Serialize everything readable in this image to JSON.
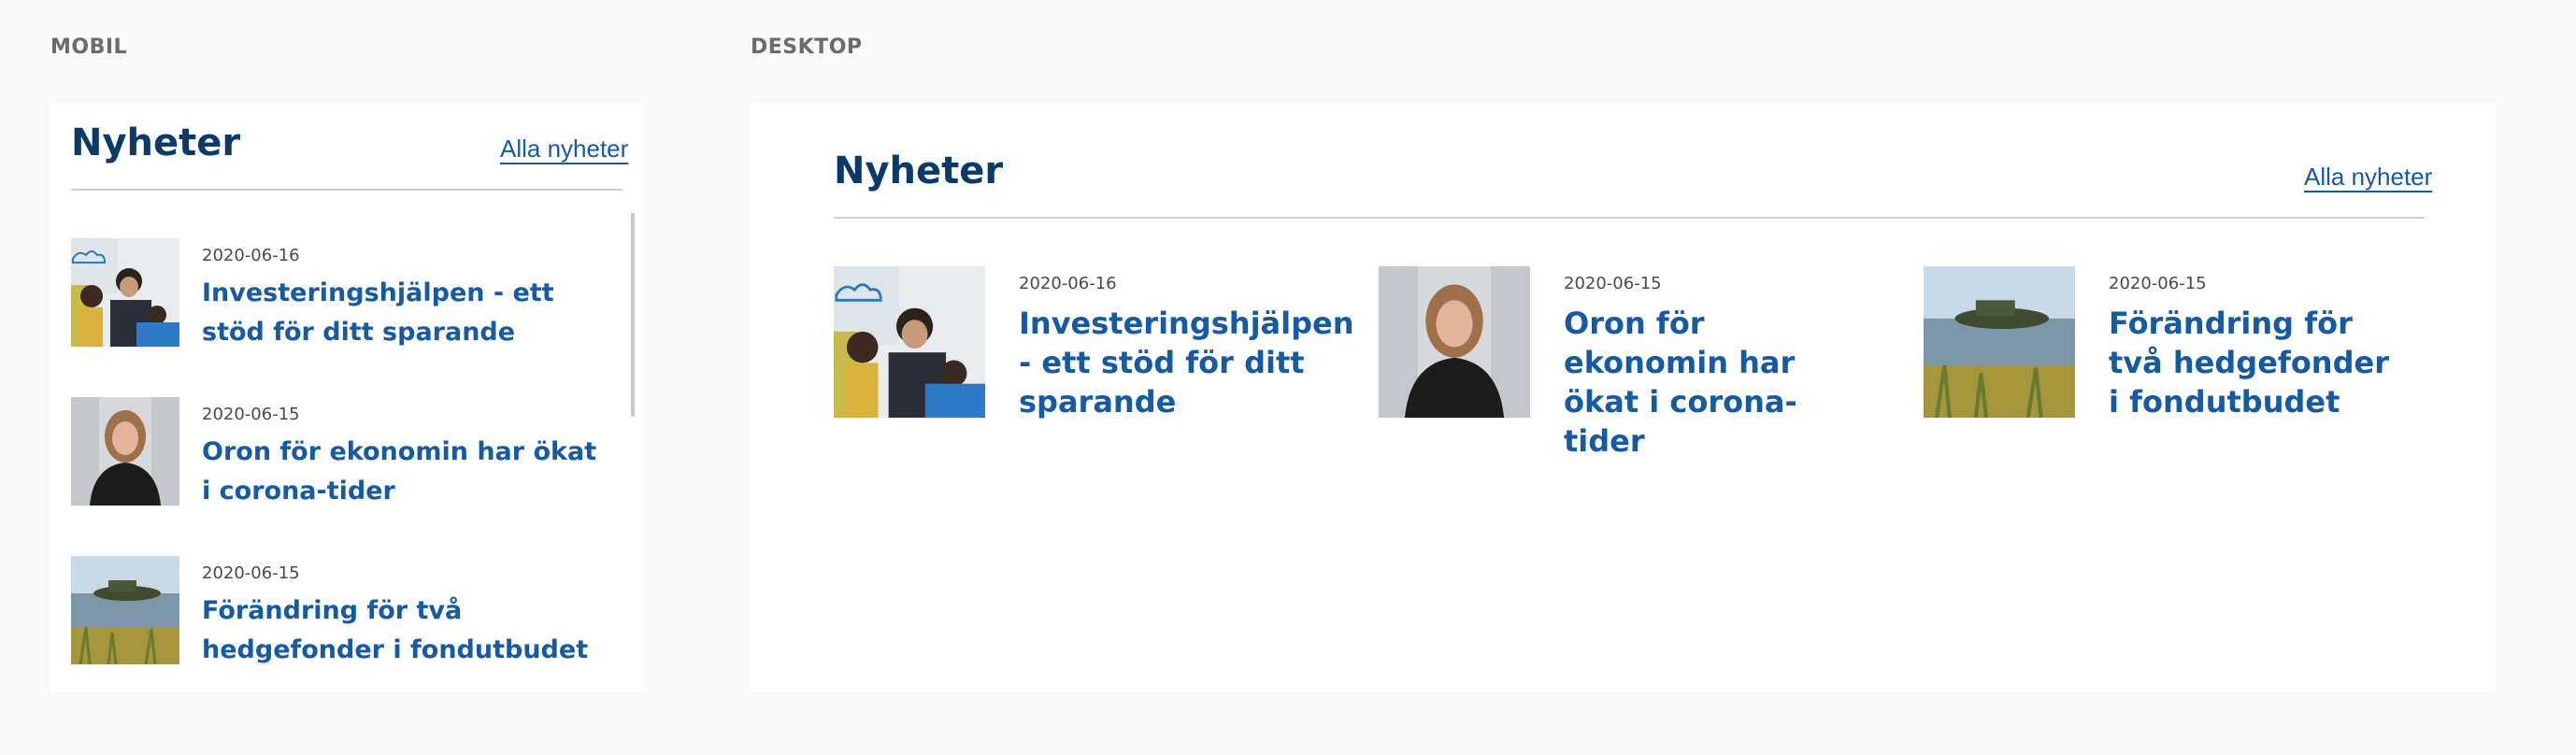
{
  "labels": {
    "mobile": "MOBIL",
    "desktop": "DESKTOP"
  },
  "module": {
    "title": "Nyheter",
    "all_link": "Alla nyheter"
  },
  "news": [
    {
      "date": "2020-06-16",
      "title": "Investeringshjälpen - ett stöd för ditt sparande",
      "image": "family-photo"
    },
    {
      "date": "2020-06-15",
      "title": "Oron för ekonomin har ökat i corona-tider",
      "image": "woman-portrait-photo"
    },
    {
      "date": "2020-06-15",
      "title": "Förändring för två hedgefonder i fondutbudet",
      "image": "lake-landscape-photo"
    }
  ],
  "colors": {
    "title": "#0b3a66",
    "link": "#155aa2",
    "background": "#f9f9f9",
    "panel": "#ffffff"
  }
}
